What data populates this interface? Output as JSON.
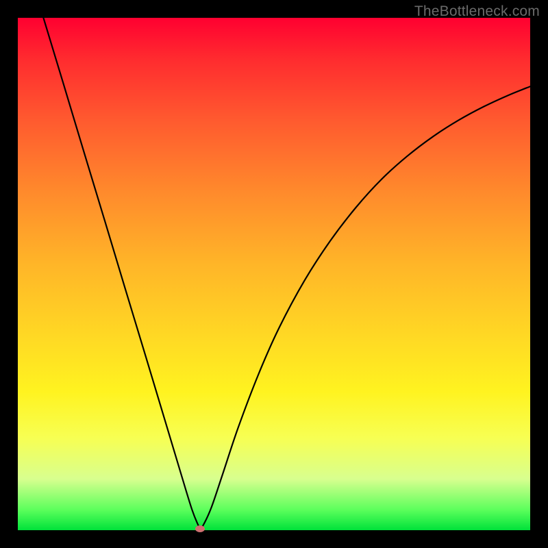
{
  "watermark": "TheBottleneck.com",
  "chart_data": {
    "type": "line",
    "title": "",
    "xlabel": "",
    "ylabel": "",
    "xlim": [
      0,
      1
    ],
    "ylim": [
      0,
      1
    ],
    "background_gradient": {
      "direction": "vertical",
      "stops": [
        {
          "pos": 0.0,
          "color": "#ff0030"
        },
        {
          "pos": 0.08,
          "color": "#ff2b2f"
        },
        {
          "pos": 0.2,
          "color": "#ff5a2f"
        },
        {
          "pos": 0.34,
          "color": "#ff8a2c"
        },
        {
          "pos": 0.48,
          "color": "#ffb528"
        },
        {
          "pos": 0.62,
          "color": "#ffd824"
        },
        {
          "pos": 0.73,
          "color": "#fff320"
        },
        {
          "pos": 0.82,
          "color": "#f7ff53"
        },
        {
          "pos": 0.9,
          "color": "#d8ff8f"
        },
        {
          "pos": 0.96,
          "color": "#5cff5c"
        },
        {
          "pos": 1.0,
          "color": "#00e23a"
        }
      ]
    },
    "series": [
      {
        "name": "bottleneck-curve",
        "color": "#000000",
        "stroke_width": 2.2,
        "points": [
          {
            "x": 0.05,
            "y": 1.0
          },
          {
            "x": 0.09,
            "y": 0.868
          },
          {
            "x": 0.13,
            "y": 0.735
          },
          {
            "x": 0.17,
            "y": 0.603
          },
          {
            "x": 0.21,
            "y": 0.47
          },
          {
            "x": 0.25,
            "y": 0.338
          },
          {
            "x": 0.29,
            "y": 0.205
          },
          {
            "x": 0.32,
            "y": 0.105
          },
          {
            "x": 0.34,
            "y": 0.04
          },
          {
            "x": 0.352,
            "y": 0.01
          },
          {
            "x": 0.356,
            "y": 0.005
          },
          {
            "x": 0.362,
            "y": 0.01
          },
          {
            "x": 0.378,
            "y": 0.045
          },
          {
            "x": 0.4,
            "y": 0.11
          },
          {
            "x": 0.43,
            "y": 0.2
          },
          {
            "x": 0.47,
            "y": 0.305
          },
          {
            "x": 0.51,
            "y": 0.395
          },
          {
            "x": 0.56,
            "y": 0.488
          },
          {
            "x": 0.61,
            "y": 0.565
          },
          {
            "x": 0.66,
            "y": 0.63
          },
          {
            "x": 0.71,
            "y": 0.685
          },
          {
            "x": 0.76,
            "y": 0.73
          },
          {
            "x": 0.81,
            "y": 0.768
          },
          {
            "x": 0.86,
            "y": 0.8
          },
          {
            "x": 0.91,
            "y": 0.827
          },
          {
            "x": 0.96,
            "y": 0.85
          },
          {
            "x": 1.0,
            "y": 0.866
          }
        ]
      }
    ],
    "marker": {
      "name": "optimal-point",
      "x": 0.356,
      "y": 0.003,
      "color": "#cf6f71",
      "shape": "ellipse"
    }
  }
}
